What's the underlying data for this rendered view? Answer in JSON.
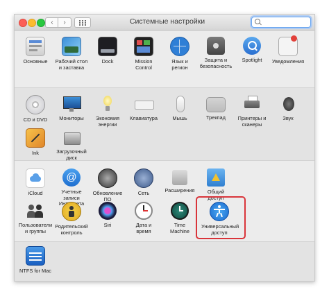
{
  "window": {
    "title": "Системные настройки",
    "search_placeholder": ""
  },
  "nav": {
    "back": "‹",
    "forward": "›"
  },
  "colors": {
    "highlight": "#d9343a",
    "search_focus": "#6aa6f0"
  },
  "sections": [
    {
      "items": [
        {
          "label": "Основные",
          "icon": "general-icon"
        },
        {
          "label": "Рабочий стол\nи заставка",
          "icon": "desktop-screensaver-icon"
        },
        {
          "label": "Dock",
          "icon": "dock-icon"
        },
        {
          "label": "Mission\nControl",
          "icon": "mission-control-icon"
        },
        {
          "label": "Язык и\nрегион",
          "icon": "language-region-icon"
        },
        {
          "label": "Защита и\nбезопасность",
          "icon": "security-icon"
        },
        {
          "label": "Spotlight",
          "icon": "spotlight-icon"
        },
        {
          "label": "Уведомления",
          "icon": "notifications-icon"
        }
      ]
    },
    {
      "items": [
        {
          "label": "CD и DVD",
          "icon": "cd-dvd-icon"
        },
        {
          "label": "Мониторы",
          "icon": "displays-icon"
        },
        {
          "label": "Экономия\nэнергии",
          "icon": "energy-saver-icon"
        },
        {
          "label": "Клавиатура",
          "icon": "keyboard-icon"
        },
        {
          "label": "Мышь",
          "icon": "mouse-icon"
        },
        {
          "label": "Трекпад",
          "icon": "trackpad-icon"
        },
        {
          "label": "Принтеры и\nсканеры",
          "icon": "printers-icon"
        },
        {
          "label": "Звук",
          "icon": "sound-icon"
        },
        {
          "label": "Ink",
          "icon": "ink-icon"
        },
        {
          "label": "Загрузочный\nдиск",
          "icon": "startup-disk-icon"
        }
      ]
    },
    {
      "items": [
        {
          "label": "iCloud",
          "icon": "icloud-icon"
        },
        {
          "label": "Учетные записи\nИнтернета",
          "icon": "internet-accounts-icon"
        },
        {
          "label": "Обновление\nПО",
          "icon": "software-update-icon"
        },
        {
          "label": "Сеть",
          "icon": "network-icon"
        },
        {
          "label": "Расширения",
          "icon": "extensions-icon"
        },
        {
          "label": "Общий\nдоступ",
          "icon": "sharing-icon"
        },
        {
          "label": "Пользователи\nи группы",
          "icon": "users-groups-icon"
        },
        {
          "label": "Родительский\nконтроль",
          "icon": "parental-controls-icon"
        },
        {
          "label": "Siri",
          "icon": "siri-icon"
        },
        {
          "label": "Дата и\nвремя",
          "icon": "date-time-icon"
        },
        {
          "label": "Time\nMachine",
          "icon": "time-machine-icon"
        },
        {
          "label": "Универсальный\nдоступ",
          "icon": "accessibility-icon",
          "highlighted": true
        }
      ]
    },
    {
      "items": [
        {
          "label": "NTFS for Mac",
          "icon": "ntfs-icon"
        }
      ]
    }
  ]
}
